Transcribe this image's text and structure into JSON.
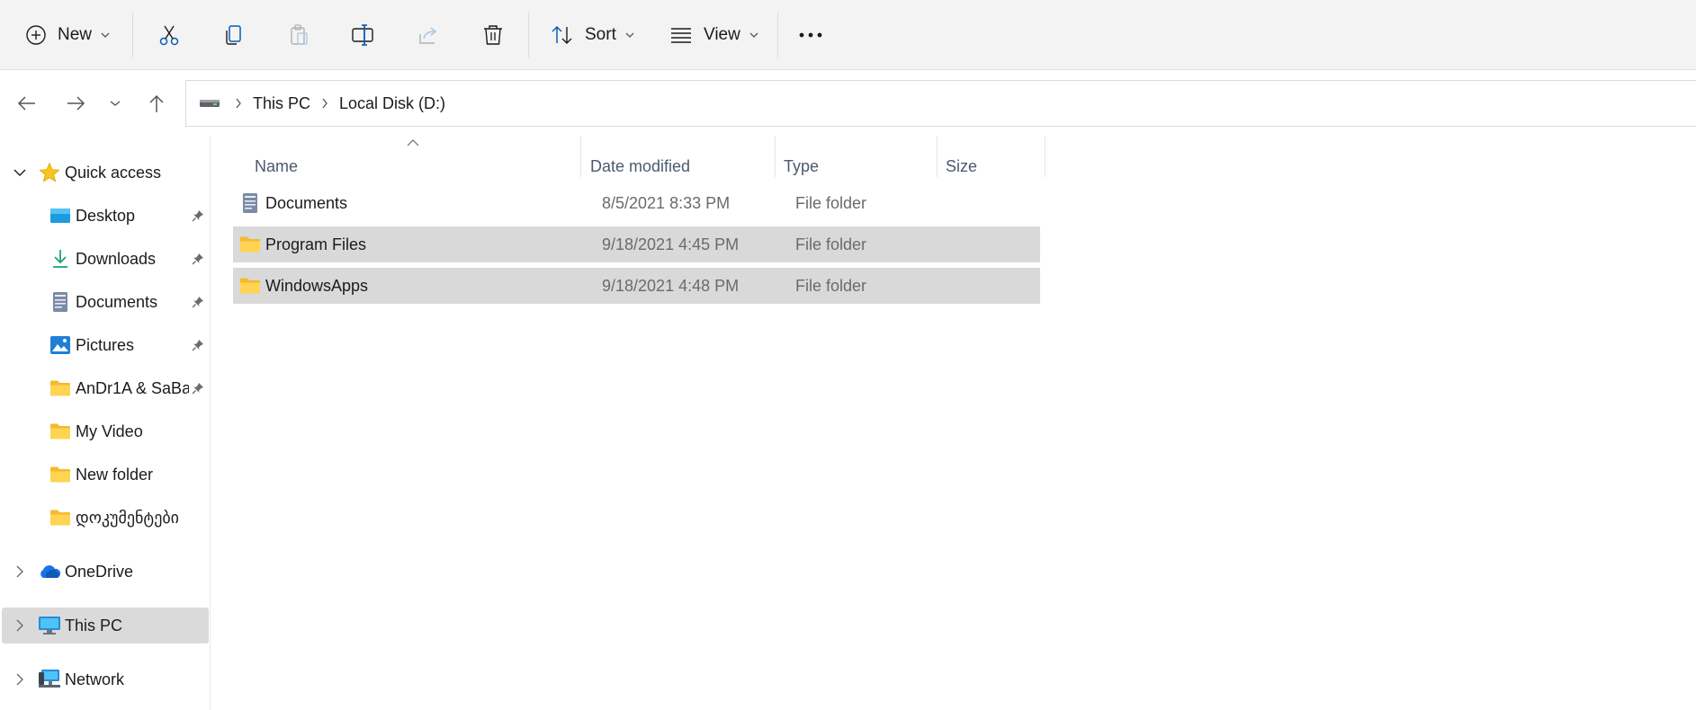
{
  "toolbar": {
    "new_label": "New",
    "sort_label": "Sort",
    "view_label": "View",
    "icons": [
      "new-icon",
      "cut-icon",
      "copy-icon",
      "paste-icon",
      "rename-icon",
      "share-icon",
      "delete-icon",
      "sort-icon",
      "view-icon",
      "more-icon"
    ]
  },
  "address": {
    "crumbs": [
      "This PC",
      "Local Disk (D:)"
    ]
  },
  "sidebar": {
    "quick_access": "Quick access",
    "items": [
      {
        "label": "Desktop",
        "icon": "desktop-icon",
        "pinned": true
      },
      {
        "label": "Downloads",
        "icon": "downloads-icon",
        "pinned": true
      },
      {
        "label": "Documents",
        "icon": "documents-icon",
        "pinned": true
      },
      {
        "label": "Pictures",
        "icon": "pictures-icon",
        "pinned": true
      },
      {
        "label": "AnDr1A & SaBa",
        "icon": "folder-icon",
        "pinned": true
      },
      {
        "label": "My Video",
        "icon": "folder-icon",
        "pinned": false
      },
      {
        "label": "New folder",
        "icon": "folder-icon",
        "pinned": false
      },
      {
        "label": "დოკუმენტები",
        "icon": "folder-icon",
        "pinned": false
      }
    ],
    "onedrive": "OneDrive",
    "this_pc": "This PC",
    "network": "Network"
  },
  "columns": {
    "name": "Name",
    "date": "Date modified",
    "type": "Type",
    "size": "Size"
  },
  "files": [
    {
      "name": "Documents",
      "date": "8/5/2021 8:33 PM",
      "type": "File folder",
      "size": "",
      "icon": "documents-icon",
      "selected": false
    },
    {
      "name": "Program Files",
      "date": "9/18/2021 4:45 PM",
      "type": "File folder",
      "size": "",
      "icon": "folder-icon",
      "selected": true
    },
    {
      "name": "WindowsApps",
      "date": "9/18/2021 4:48 PM",
      "type": "File folder",
      "size": "",
      "icon": "folder-icon",
      "selected": true
    }
  ],
  "colors": {
    "accent": "#0067c0",
    "folder": "#f8c94a",
    "selection": "#d9d9d9"
  }
}
